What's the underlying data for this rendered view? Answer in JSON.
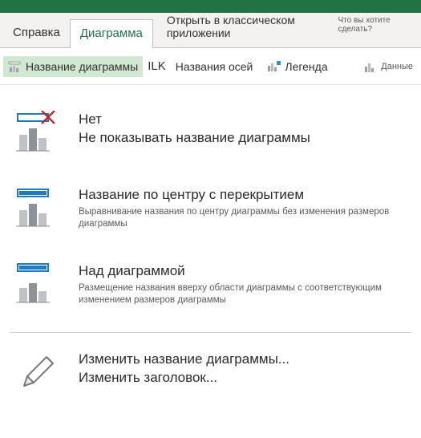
{
  "tabs": {
    "help": "Справка",
    "chart": "Диаграмма",
    "open_desktop": "Открыть в классическом приложении",
    "tell_me": "Что вы хотите сделать?"
  },
  "ribbon": {
    "chart_title": "Название диаграммы",
    "axis_ilk": "ILK",
    "axis_titles": "Названия осей",
    "legend": "Легенда",
    "data": "Данные"
  },
  "menu": {
    "none": {
      "title": "Нет",
      "desc": "Не показывать название диаграммы"
    },
    "centered": {
      "title": "Название по центру с перекрытием",
      "desc": "Выравнивание названия по центру диаграммы без изменения размеров диаграммы"
    },
    "above": {
      "title": "Над диаграммой",
      "desc": "Размещение названия вверху области диаграммы с соответствующим изменением размеров диаграммы"
    },
    "edit": {
      "title": "Изменить название диаграммы...",
      "desc": "Изменить заголовок..."
    }
  }
}
